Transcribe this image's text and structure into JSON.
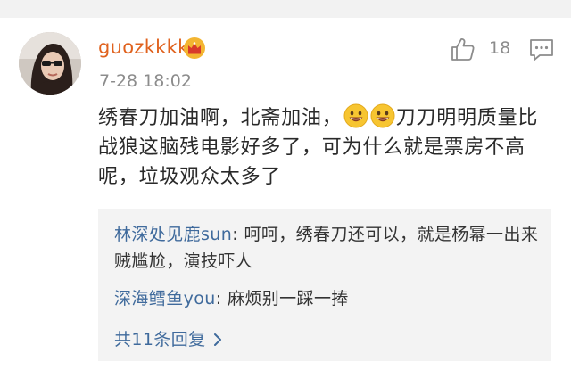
{
  "comment": {
    "username": "guozkkkk",
    "badge_icon": "crown-icon",
    "timestamp": "7-28 18:02",
    "like_icon": "thumbs-up-icon",
    "like_count": "18",
    "comment_icon": "comment-icon",
    "text_part1": "绣春刀加油啊，北斋加油，",
    "emojis": [
      "grinning-face-emoji",
      "grinning-face-emoji"
    ],
    "text_part2": "刀刀明明质量比战狼这脑残电影好多了，可为什么就是票房不高呢，垃圾观众太多了"
  },
  "replies": [
    {
      "user": "林深处见鹿sun",
      "separator": ":",
      "text": " 呵呵，绣春刀还可以，就是杨幂一出来贼尴尬，演技吓人"
    },
    {
      "user": "深海鳕鱼you",
      "separator": ":",
      "text": " 麻烦别一踩一捧"
    }
  ],
  "more_replies": {
    "label": "共11条回复",
    "icon": "chevron-right-icon"
  },
  "colors": {
    "username": "#e0621e",
    "reply_user": "#3f6a9c",
    "meta_gray": "#8c8c8c",
    "body_text": "#2a2a2a",
    "reply_bg": "#f3f3f3",
    "emoji_face": "#f7c531"
  }
}
